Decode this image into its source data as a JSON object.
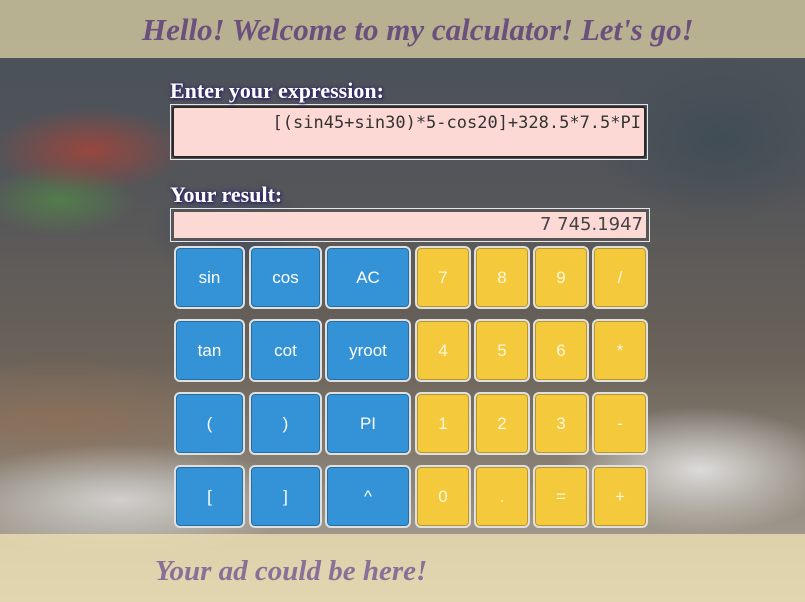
{
  "header": {
    "title": "Hello! Welcome to my calculator! Let's go!"
  },
  "expression": {
    "label": "Enter your expression:",
    "value": "[(sin45+sin30)*5-cos20]+328.5*7.5*PI"
  },
  "result": {
    "label": "Your result:",
    "value": "7 745.1947"
  },
  "keypad": {
    "rows": [
      [
        "sin",
        "cos",
        "AC",
        "7",
        "8",
        "9",
        "/"
      ],
      [
        "tan",
        "cot",
        "yroot",
        "4",
        "5",
        "6",
        "*"
      ],
      [
        "(",
        ")",
        "PI",
        "1",
        "2",
        "3",
        "-"
      ],
      [
        "[",
        "]",
        "^",
        "0",
        ".",
        "=",
        "+"
      ]
    ]
  },
  "footer": {
    "ad_text": "Your ad could be here!"
  },
  "colors": {
    "function_button": "#3492d6",
    "digit_button": "#f4ca3c",
    "display_background": "#fdd9d6",
    "header_title": "#6b4f7c",
    "footer_text": "#8a6f99"
  }
}
